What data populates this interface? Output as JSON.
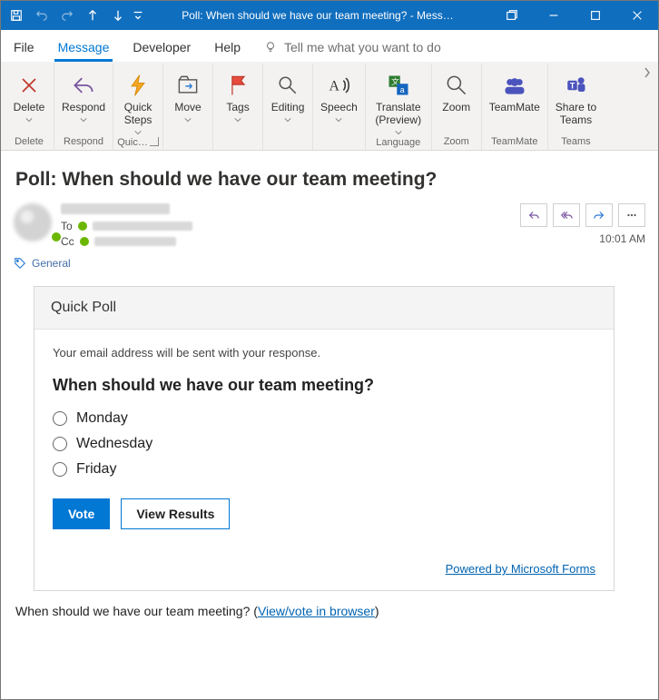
{
  "titlebar": {
    "title": "Poll: When should we have our team meeting?  -  Mess…"
  },
  "ribbon": {
    "tabs": {
      "file": "File",
      "message": "Message",
      "developer": "Developer",
      "help": "Help"
    },
    "tellme_placeholder": "Tell me what you want to do",
    "groups": {
      "delete": {
        "label": "Delete",
        "btn": "Delete"
      },
      "respond": {
        "label": "Respond",
        "btn": "Respond"
      },
      "quicksteps": {
        "label": "Quic…",
        "btn": "Quick\nSteps"
      },
      "move": {
        "label": "",
        "btn": "Move"
      },
      "tags": {
        "label": "",
        "btn": "Tags"
      },
      "editing": {
        "label": "",
        "btn": "Editing"
      },
      "speech": {
        "label": "",
        "btn": "Speech"
      },
      "language": {
        "label": "Language",
        "btn": "Translate\n(Preview)"
      },
      "zoom": {
        "label": "Zoom",
        "btn": "Zoom"
      },
      "teammate": {
        "label": "TeamMate",
        "btn": "TeamMate"
      },
      "teams": {
        "label": "Teams",
        "btn": "Share to\nTeams"
      }
    }
  },
  "message": {
    "subject": "Poll: When should we have our team meeting?",
    "to_label": "To",
    "cc_label": "Cc",
    "timestamp": "10:01 AM",
    "category": "General"
  },
  "poll": {
    "header": "Quick Poll",
    "disclaimer": "Your email address will be sent with your response.",
    "question": "When should we have our team meeting?",
    "options": [
      "Monday",
      "Wednesday",
      "Friday"
    ],
    "vote_label": "Vote",
    "results_label": "View Results",
    "credit": "Powered by Microsoft Forms"
  },
  "footer": {
    "text": "When should we have our team meeting? (",
    "link": "View/vote in browser",
    "after": ")"
  }
}
